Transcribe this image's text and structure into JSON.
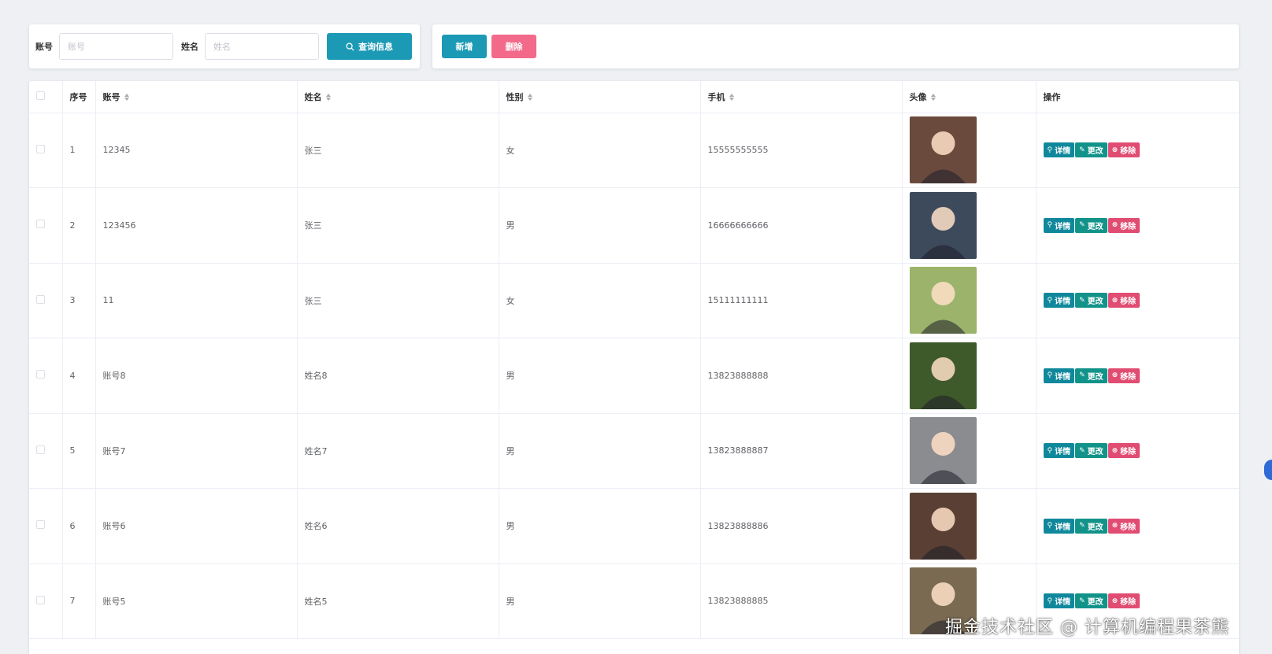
{
  "search": {
    "account_label": "账号",
    "account_placeholder": "账号",
    "name_label": "姓名",
    "name_placeholder": "姓名",
    "search_button": "查询信息"
  },
  "actions": {
    "add_button": "新增",
    "delete_button": "删除"
  },
  "table": {
    "headers": {
      "index": "序号",
      "account": "账号",
      "name": "姓名",
      "gender": "性别",
      "phone": "手机",
      "avatar": "头像",
      "ops": "操作"
    },
    "row_actions": {
      "detail": "详情",
      "edit": "更改",
      "remove": "移除"
    },
    "rows": [
      {
        "index": "1",
        "account": "12345",
        "name": "张三",
        "gender": "女",
        "phone": "15555555555",
        "avatar_color": "#6b4a3e"
      },
      {
        "index": "2",
        "account": "123456",
        "name": "张三",
        "gender": "男",
        "phone": "16666666666",
        "avatar_color": "#3d4a5c"
      },
      {
        "index": "3",
        "account": "11",
        "name": "张三",
        "gender": "女",
        "phone": "15111111111",
        "avatar_color": "#9bb36a"
      },
      {
        "index": "4",
        "account": "账号8",
        "name": "姓名8",
        "gender": "男",
        "phone": "13823888888",
        "avatar_color": "#3f5a2a"
      },
      {
        "index": "5",
        "account": "账号7",
        "name": "姓名7",
        "gender": "男",
        "phone": "13823888887",
        "avatar_color": "#8a8c90"
      },
      {
        "index": "6",
        "account": "账号6",
        "name": "姓名6",
        "gender": "男",
        "phone": "13823888886",
        "avatar_color": "#5a4034"
      },
      {
        "index": "7",
        "account": "账号5",
        "name": "姓名5",
        "gender": "男",
        "phone": "13823888885",
        "avatar_color": "#7a6a52"
      }
    ]
  },
  "watermark": "掘金技术社区 @ 计算机编程果茶熊",
  "colors": {
    "primary": "#1c9ab5",
    "danger": "#f3698a",
    "detail": "#10889c",
    "edit": "#12938a",
    "remove": "#e14d72"
  }
}
